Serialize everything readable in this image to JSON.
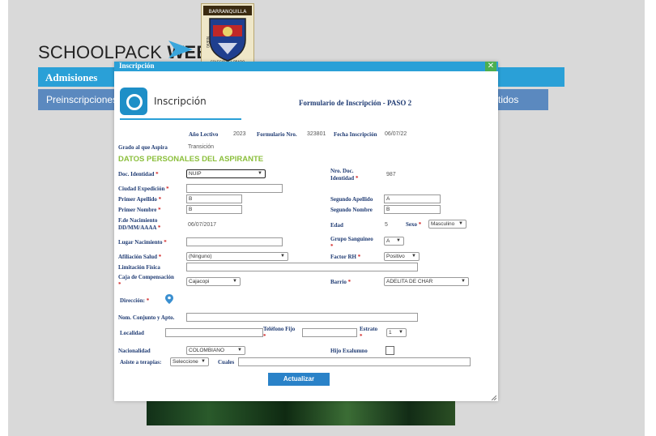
{
  "app": {
    "brand_prefix": "SCHOOLPACK ",
    "brand_bold": "WEB",
    "crest_text_top": "BARRANQUILLA",
    "crest_text_bottom": "COLEGIO DEL PRADO",
    "crest_text_side": "NUEVO"
  },
  "nav": {
    "main": "Admisiones",
    "sub_left": "Preinscripciones",
    "sub_right": "tidos"
  },
  "modal": {
    "window_title": "Inscripción",
    "close_label": "✕",
    "header_title": "Inscripción",
    "form_title": "Formulario de Inscripción - PASO 2"
  },
  "summary": {
    "anio_label": "Año Lectivo",
    "anio_value": "2023",
    "formulario_label": "Formulario Nro.",
    "formulario_value": "323801",
    "fecha_label": "Fecha Inscripción",
    "fecha_value": "06/07/22",
    "grado_label": "Grado al que Aspira",
    "grado_value": "Transición"
  },
  "section_title": "DATOS PERSONALES DEL ASPIRANTE",
  "fields": {
    "doc_identidad_label": "Doc. Identidad",
    "doc_identidad_value": "NUIP",
    "nro_doc_label_1": "Nro. Doc.",
    "nro_doc_label_2": "Identidad",
    "nro_doc_value": "987",
    "ciudad_label": "Ciudad Expedición",
    "ciudad_value": "",
    "primer_apellido_label": "Primer Apellido",
    "primer_apellido_value": "B",
    "segundo_apellido_label": "Segundo Apellido",
    "segundo_apellido_value": "A",
    "primer_nombre_label": "Primer Nombre",
    "primer_nombre_value": "B",
    "segundo_nombre_label": "Segundo Nombre",
    "segundo_nombre_value": "B",
    "fnac_label_1": "F.de Nacimiento",
    "fnac_label_2": "DD/MM/AAAA",
    "fnac_value": "06/07/2017",
    "edad_label": "Edad",
    "edad_value": "5",
    "sexo_label": "Sexo",
    "sexo_value": "Masculino",
    "lugar_nac_label": "Lugar Nacimiento",
    "lugar_nac_value": "",
    "grupo_sang_label_1": "Grupo Sanguineo",
    "grupo_sang_value": "A",
    "afiliacion_label": "Afiliación Salud",
    "afiliacion_value": "(Ninguno)",
    "factor_rh_label": "Factor RH",
    "factor_rh_value": "Positivo",
    "limitacion_label": "Limitación Física",
    "limitacion_value": "",
    "caja_label": "Caja de Compensación",
    "caja_value": "Cajacopi",
    "barrio_label": "Barrio",
    "barrio_value": "ADELITA DE CHAR",
    "direccion_label": "Dirección:",
    "nom_conjunto_label": "Nom. Conjunto y Apto.",
    "nom_conjunto_value": "",
    "localidad_label": "Localidad",
    "localidad_value": "",
    "telefono_label": "Teléfono Fijo",
    "telefono_value": "",
    "estrato_label": "Estrato",
    "estrato_value": "1",
    "nacionalidad_label": "Nacionalidad",
    "nacionalidad_value": "COLOMBIANO",
    "hijo_exalumno_label": "Hijo Exalumno",
    "asiste_label": "Asiste a terapias:",
    "asiste_value": "Seleccione",
    "cuales_label": "Cuales",
    "cuales_value": "",
    "required_mark": "*"
  },
  "actions": {
    "actualizar_label": "Actualizar"
  },
  "colors": {
    "accent_blue": "#2aa0d7",
    "nav_grey_blue": "#5b89bf",
    "label_navy": "#1f3b73",
    "section_green": "#8bbf3c",
    "close_green": "#4caf50"
  }
}
